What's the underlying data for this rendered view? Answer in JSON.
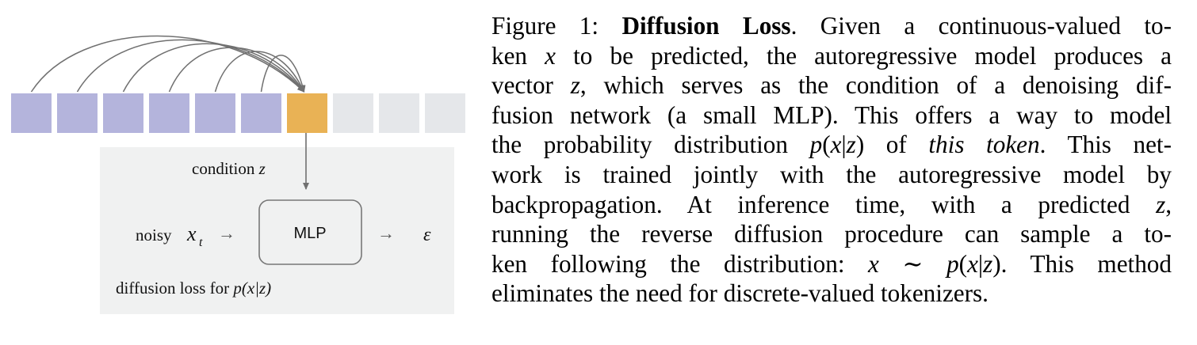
{
  "figure": {
    "condition_label": "condition",
    "condition_var": "z",
    "noisy_label": "noisy",
    "noisy_var": "x",
    "noisy_sub": "t",
    "mlp_label": "MLP",
    "output_symbol": "ε",
    "loss_label_prefix": "diffusion loss for ",
    "loss_label_math": "p(x|z)",
    "arrow_glyph": "→",
    "colors": {
      "past_token": "#b4b4dc",
      "current_token": "#e9b255",
      "future_token": "#e5e7ea",
      "panel_bg": "#f0f1f1",
      "arrow": "#707070",
      "mlp_border": "#777777"
    },
    "token_counts": {
      "past": 6,
      "current": 1,
      "future": 3
    }
  },
  "caption": {
    "lines": [
      [
        {
          "t": "Figure 1: ",
          "c": "fig-label"
        },
        {
          "t": "Diffusion Loss",
          "c": "fig-title"
        },
        {
          "t": ". Given a continuous-valued to-"
        }
      ],
      [
        {
          "t": "ken "
        },
        {
          "t": "x",
          "c": "math"
        },
        {
          "t": " to be predicted, the autoregressive model produces a"
        }
      ],
      [
        {
          "t": "vector "
        },
        {
          "t": "z",
          "c": "math"
        },
        {
          "t": ", which serves as the condition of a denoising dif-"
        }
      ],
      [
        {
          "t": "fusion network (a small MLP). This offers a way to model"
        }
      ],
      [
        {
          "t": "the probability distribution "
        },
        {
          "t": "p",
          "c": "math"
        },
        {
          "t": "("
        },
        {
          "t": "x",
          "c": "math"
        },
        {
          "t": "|"
        },
        {
          "t": "z",
          "c": "math"
        },
        {
          "t": ") of "
        },
        {
          "t": "this token",
          "c": "emph"
        },
        {
          "t": ". This net-"
        }
      ],
      [
        {
          "t": "work is trained jointly with the autoregressive model by"
        }
      ],
      [
        {
          "t": "backpropagation.  At inference time, with a predicted "
        },
        {
          "t": "z",
          "c": "math"
        },
        {
          "t": ","
        }
      ],
      [
        {
          "t": "running the reverse diffusion procedure can sample a to-"
        }
      ],
      [
        {
          "t": "ken following the distribution: "
        },
        {
          "t": "x",
          "c": "math"
        },
        {
          "t": " ∼ "
        },
        {
          "t": "p",
          "c": "math"
        },
        {
          "t": "("
        },
        {
          "t": "x",
          "c": "math"
        },
        {
          "t": "|"
        },
        {
          "t": "z",
          "c": "math"
        },
        {
          "t": "). This method"
        }
      ],
      [
        {
          "t": "eliminates the need for discrete-valued tokenizers."
        }
      ]
    ]
  }
}
